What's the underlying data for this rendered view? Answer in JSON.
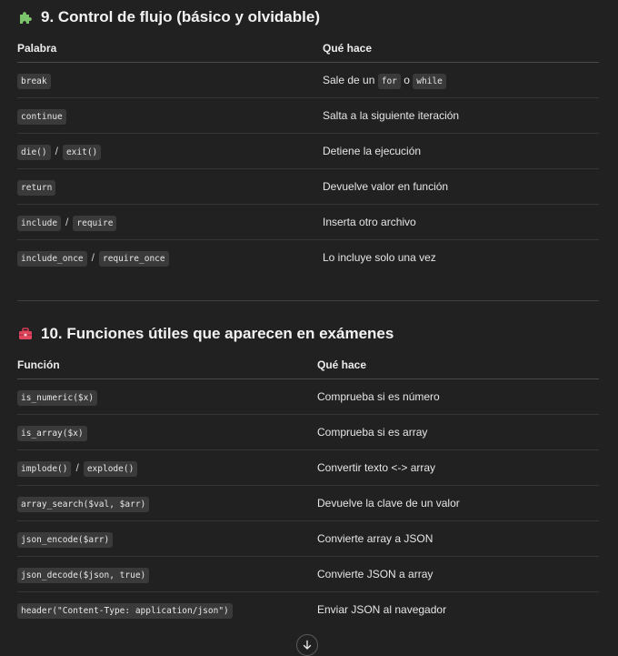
{
  "section1": {
    "emoji": "puzzle-piece-icon",
    "title": "9. Control de flujo (básico y olvidable)",
    "headers": [
      "Palabra",
      "Qué hace"
    ],
    "rows": [
      {
        "codes": [
          "break"
        ],
        "desc_parts": [
          "Sale de un",
          "for",
          "o",
          "while"
        ]
      },
      {
        "codes": [
          "continue"
        ],
        "desc": "Salta a la siguiente iteración"
      },
      {
        "codes": [
          "die()",
          "exit()"
        ],
        "sep": "/",
        "desc": "Detiene la ejecución"
      },
      {
        "codes": [
          "return"
        ],
        "desc": "Devuelve valor en función"
      },
      {
        "codes": [
          "include",
          "require"
        ],
        "sep": "/",
        "desc": "Inserta otro archivo"
      },
      {
        "codes": [
          "include_once",
          "require_once"
        ],
        "sep": "/",
        "desc": "Lo incluye solo una vez"
      }
    ]
  },
  "section2": {
    "emoji": "toolbox-icon",
    "title": "10. Funciones útiles que aparecen en exámenes",
    "headers": [
      "Función",
      "Qué hace"
    ],
    "rows": [
      {
        "codes": [
          "is_numeric($x)"
        ],
        "desc": "Comprueba si es número"
      },
      {
        "codes": [
          "is_array($x)"
        ],
        "desc": "Comprueba si es array"
      },
      {
        "codes": [
          "implode()",
          "explode()"
        ],
        "sep": "/",
        "desc": "Convertir texto <-> array"
      },
      {
        "codes": [
          "array_search($val, $arr)"
        ],
        "desc": "Devuelve la clave de un valor"
      },
      {
        "codes": [
          "json_encode($arr)"
        ],
        "desc": "Convierte array a JSON"
      },
      {
        "codes": [
          "json_decode($json, true)"
        ],
        "desc": "Convierte JSON a array"
      },
      {
        "codes": [
          "header(\"Content-Type: application/json\")"
        ],
        "desc": "Enviar JSON al navegador"
      }
    ]
  },
  "scroll_button": {
    "icon": "arrow-down-icon"
  },
  "colors": {
    "background": "#212121",
    "code_bg": "#3a3a3a",
    "text": "#ececec"
  }
}
